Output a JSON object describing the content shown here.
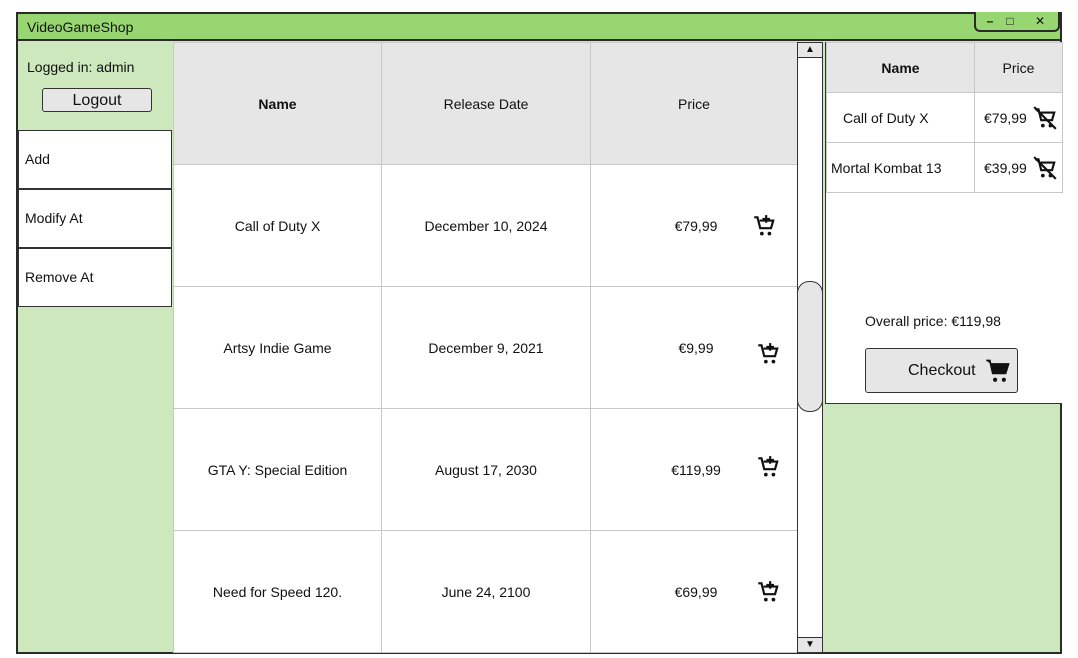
{
  "window": {
    "title": "VideoGameShop",
    "controls": [
      "–",
      "□",
      "✕"
    ]
  },
  "sidebar": {
    "logged_in": "Logged in: admin",
    "logout_label": "Logout",
    "items": [
      {
        "label": "Add"
      },
      {
        "label": "Modify At"
      },
      {
        "label": "Remove At"
      }
    ]
  },
  "catalog": {
    "headers": {
      "name": "Name",
      "release": "Release Date",
      "price": "Price"
    },
    "rows": [
      {
        "name": "Call of Duty X",
        "release": "December 10, 2024",
        "price": "€79,99",
        "action_icon": "add-to-cart-icon"
      },
      {
        "name": "Artsy Indie Game",
        "release": "December 9, 2021",
        "price": "€9,99",
        "action_icon": "add-to-cart-icon"
      },
      {
        "name": "GTA Y: Special Edition",
        "release": "August 17, 2030",
        "price": "€119,99",
        "action_icon": "add-to-cart-icon"
      },
      {
        "name": "Need for Speed 120.",
        "release": "June 24, 2100",
        "price": "€69,99",
        "action_icon": "add-to-cart-icon"
      }
    ]
  },
  "scrollbar": {
    "up": "▲",
    "down": "▼"
  },
  "cart": {
    "headers": {
      "name": "Name",
      "price": "Price"
    },
    "items": [
      {
        "name": "Call of Duty X",
        "price": "€79,99",
        "action_icon": "remove-from-cart-icon"
      },
      {
        "name": "Mortal Kombat 13",
        "price": "€39,99",
        "action_icon": "remove-from-cart-icon"
      }
    ],
    "overall": "Overall price: €119,98",
    "checkout_label": "Checkout"
  },
  "colors": {
    "titlebar": "#98d672",
    "panel_bg": "#cde8bd",
    "header_bg": "#e6e6e6"
  }
}
